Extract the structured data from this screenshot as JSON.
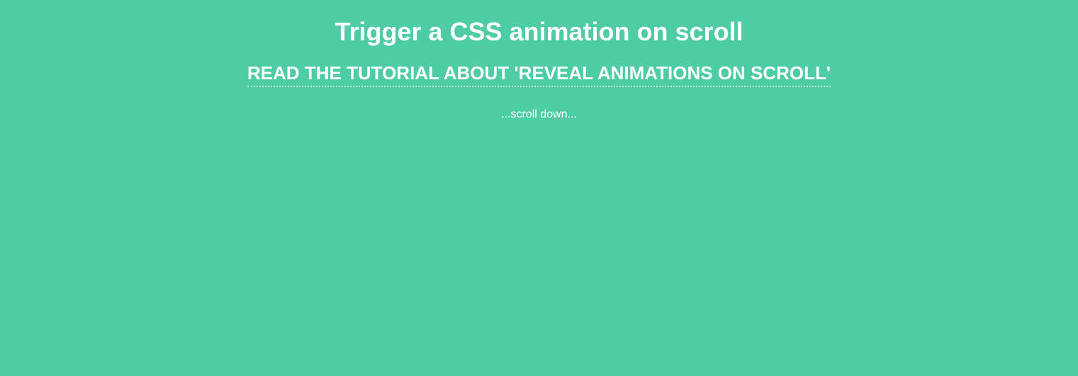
{
  "header": {
    "title": "Trigger a CSS animation on scroll",
    "tutorial_link_text": "READ THE TUTORIAL ABOUT 'REVEAL ANIMATIONS ON SCROLL'",
    "scroll_hint": "...scroll down..."
  }
}
